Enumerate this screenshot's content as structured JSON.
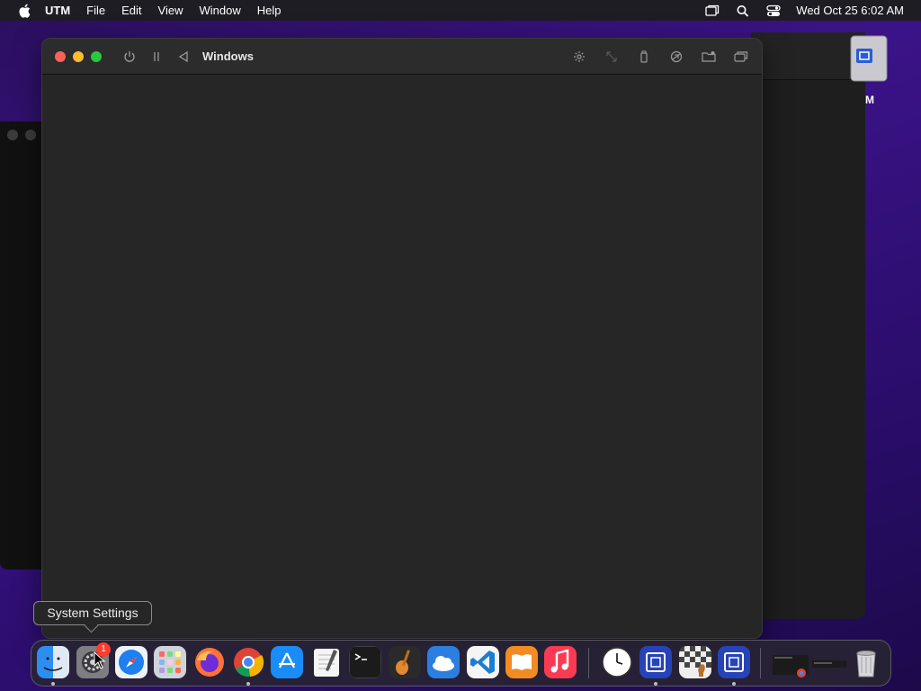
{
  "menubar": {
    "app_name": "UTM",
    "items": [
      "File",
      "Edit",
      "View",
      "Window",
      "Help"
    ],
    "status_icons": [
      "display-mirror-icon",
      "search-icon",
      "control-center-icon"
    ],
    "clock": "Wed Oct 25  6:02 AM"
  },
  "desktop": {
    "icon_label": "M"
  },
  "utm_window": {
    "title": "Windows",
    "toolbar_left": [
      "power-icon",
      "pause-icon",
      "back-icon"
    ],
    "toolbar_right": [
      "display-brightness-icon",
      "resize-icon",
      "usb-icon",
      "shared-folder-icon",
      "folder-icon",
      "windows-icon"
    ]
  },
  "tooltip": {
    "text": "System Settings"
  },
  "dock": {
    "badge_count": "1",
    "apps": [
      "finder-icon",
      "system-settings-icon",
      "safari-icon",
      "launchpad-icon",
      "firefox-icon",
      "chrome-icon",
      "app-store-icon",
      "textedit-icon",
      "terminal-icon",
      "garageband-icon",
      "weather-icon",
      "vscode-icon",
      "books-icon",
      "music-icon",
      "clock-icon",
      "utm-icon",
      "chess-icon",
      "utm-icon-2",
      "minimized-window-icon",
      "trash-icon"
    ]
  }
}
